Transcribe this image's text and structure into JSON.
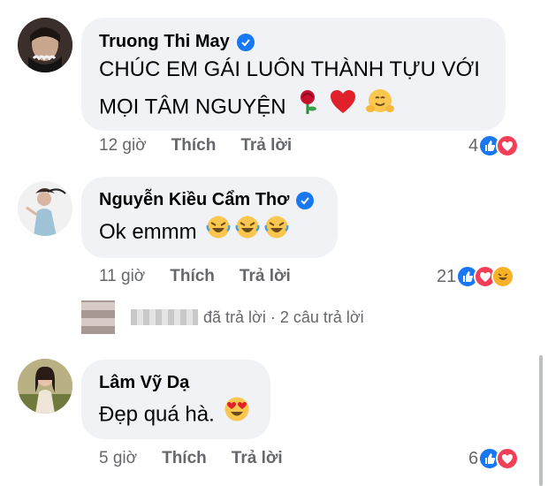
{
  "comments": [
    {
      "name": "Truong Thi May",
      "verified": true,
      "lines": [
        "CHÚC EM GÁI LUÔN THÀNH TỰU VỚI",
        "MỌI TÂM NGUYỆN"
      ],
      "emojis": [
        "rose-icon",
        "red-heart-icon",
        "hugging-face-icon"
      ],
      "time": "12 giờ",
      "like_label": "Thích",
      "reply_label": "Trả lời",
      "reaction_count": "4",
      "reactions": [
        "like",
        "love"
      ]
    },
    {
      "name": "Nguyễn Kiều Cẩm Thơ",
      "verified": true,
      "lines": [
        "Ok emmm"
      ],
      "emojis": [
        "rofl-icon",
        "rofl-icon",
        "rofl-icon"
      ],
      "time": "11 giờ",
      "like_label": "Thích",
      "reply_label": "Trả lời",
      "reaction_count": "21",
      "reactions": [
        "like",
        "love",
        "haha"
      ]
    },
    {
      "name": "Lâm Vỹ Dạ",
      "verified": false,
      "lines": [
        "Đẹp quá hà."
      ],
      "emojis": [
        "heart-eyes-icon"
      ],
      "time": "5 giờ",
      "like_label": "Thích",
      "reply_label": "Trả lời",
      "reaction_count": "6",
      "reactions": [
        "like",
        "love"
      ]
    }
  ],
  "reply_summary": "đã trả lời · 2 câu trả lời",
  "colors": {
    "bubble": "#f0f2f5",
    "meta_text": "#65676b",
    "verified": "#1877f2",
    "like": "#1877f2",
    "love": "#f33e58",
    "haha": "#f7b125"
  }
}
